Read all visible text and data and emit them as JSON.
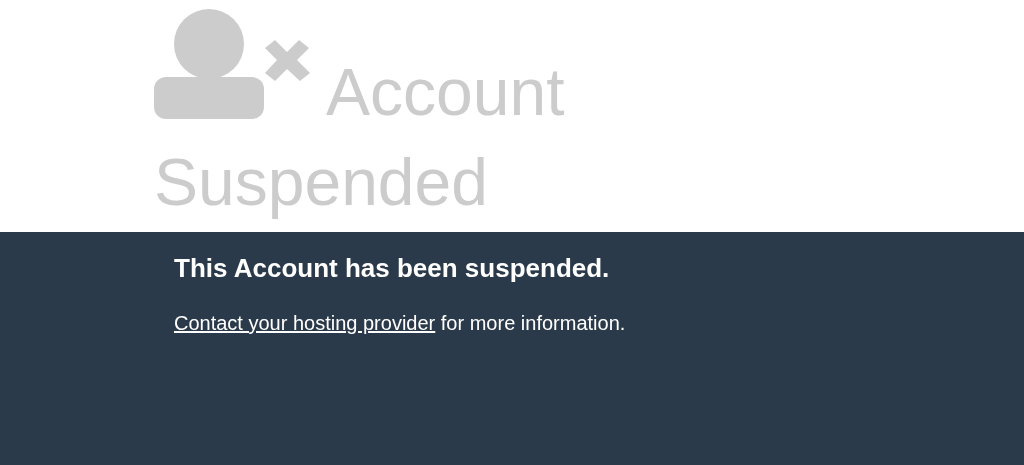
{
  "heading": "Account Suspended",
  "message": "This Account has been suspended.",
  "info": {
    "link": "Contact your hosting provider",
    "text": " for more information."
  }
}
